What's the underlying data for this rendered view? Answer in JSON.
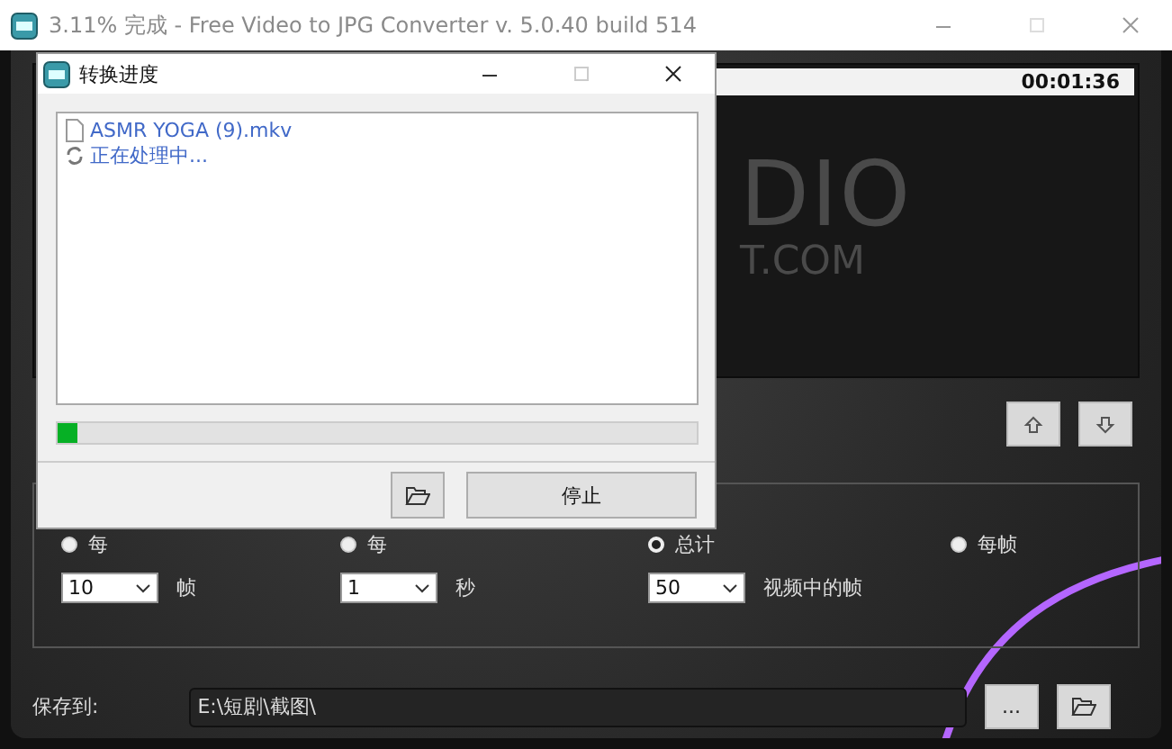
{
  "window": {
    "title": "3.11% 完成 - Free Video to JPG Converter  v. 5.0.40 build 514"
  },
  "preview": {
    "time": "00:01:36",
    "logo_lines": [
      "DIO",
      "T.COM"
    ]
  },
  "extract_options": [
    {
      "label": "每",
      "selected": false,
      "value": "10",
      "unit": "帧"
    },
    {
      "label": "每",
      "selected": false,
      "value": "1",
      "unit": "秒"
    },
    {
      "label": "总计",
      "selected": true,
      "value": "50",
      "unit": "视频中的帧"
    },
    {
      "label": "每帧",
      "selected": false
    }
  ],
  "save": {
    "label": "保存到:",
    "path": "E:\\短剧\\截图\\",
    "browse_button": "..."
  },
  "dialog": {
    "title": "转换进度",
    "items": [
      {
        "kind": "file",
        "text": "ASMR YOGA (9).mkv"
      },
      {
        "kind": "status",
        "text": "正在处理中..."
      }
    ],
    "progress": {
      "level": 0.0311
    },
    "stop_button": "停止"
  }
}
